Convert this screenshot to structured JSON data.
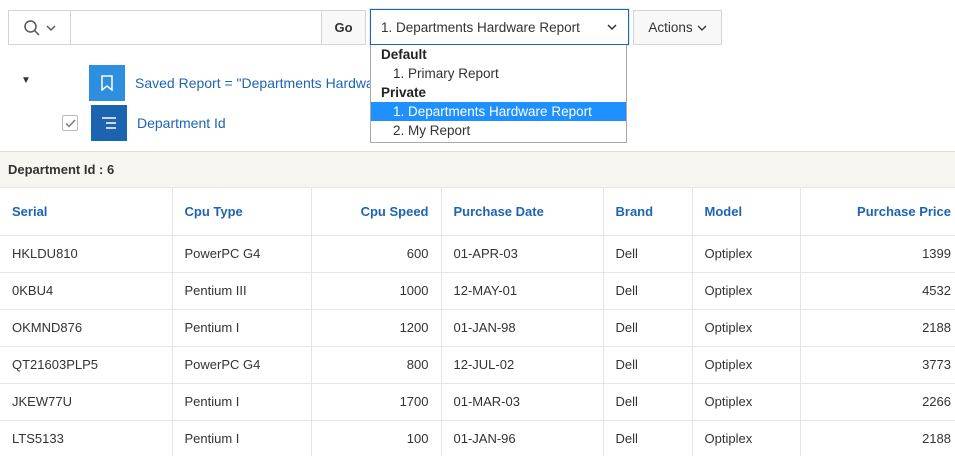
{
  "toolbar": {
    "search_value": "",
    "go_label": "Go",
    "report_selected": "1. Departments Hardware Report",
    "actions_label": "Actions"
  },
  "report_menu": {
    "groups": [
      {
        "label": "Default",
        "items": [
          "1. Primary Report"
        ]
      },
      {
        "label": "Private",
        "items": [
          "1. Departments Hardware Report",
          "2. My Report"
        ]
      }
    ],
    "selected_item": "1. Departments Hardware Report"
  },
  "settings": {
    "saved_report_label": "Saved Report = \"Departments Hardware Report\"",
    "break_label": "Department Id",
    "break_enabled": true
  },
  "control_break": {
    "label": "Department Id : 6"
  },
  "table": {
    "columns": [
      "Serial",
      "Cpu Type",
      "Cpu Speed",
      "Purchase Date",
      "Brand",
      "Model",
      "Purchase Price"
    ],
    "rows": [
      [
        "HKLDU810",
        "PowerPC G4",
        "600",
        "01-APR-03",
        "Dell",
        "Optiplex",
        "1399"
      ],
      [
        "0KBU4",
        "Pentium III",
        "1000",
        "12-MAY-01",
        "Dell",
        "Optiplex",
        "4532"
      ],
      [
        "OKMND876",
        "Pentium I",
        "1200",
        "01-JAN-98",
        "Dell",
        "Optiplex",
        "2188"
      ],
      [
        "QT21603PLP5",
        "PowerPC G4",
        "800",
        "12-JUL-02",
        "Dell",
        "Optiplex",
        "3773"
      ],
      [
        "JKEW77U",
        "Pentium I",
        "1700",
        "01-MAR-03",
        "Dell",
        "Optiplex",
        "2266"
      ],
      [
        "LTS5133",
        "Pentium I",
        "100",
        "01-JAN-96",
        "Dell",
        "Optiplex",
        "2188"
      ]
    ]
  },
  "icons": {
    "search": "search-icon",
    "chevron": "chevron-down-icon",
    "bookmark": "bookmark-icon",
    "break": "control-break-icon",
    "collapse": "collapse-triangle-icon",
    "check": "check-icon"
  },
  "colors": {
    "link": "#1e63b5",
    "highlight": "#1e90ff",
    "saved_report_icon_bg": "#2e8ee0",
    "break_icon_bg": "#1d64b0",
    "break_bar_bg": "#f7f5f0"
  }
}
